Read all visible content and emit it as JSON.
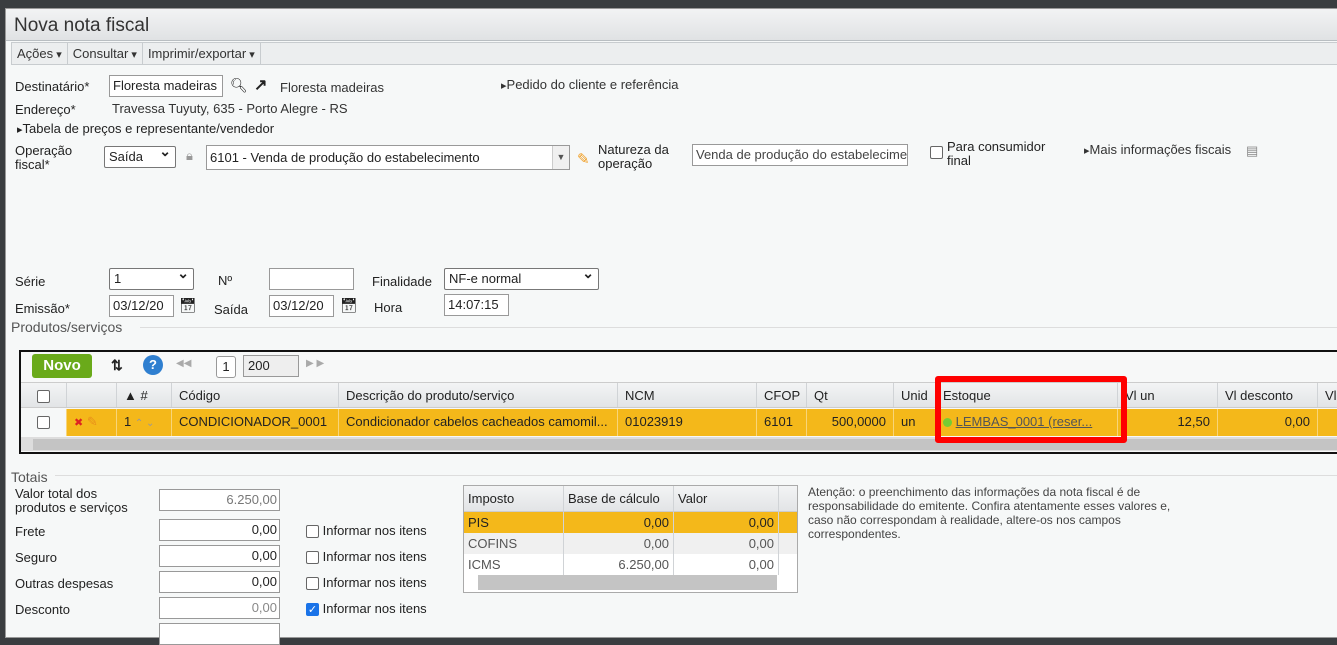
{
  "window": {
    "title": "Nova nota fiscal"
  },
  "menu": [
    "Ações",
    "Consultar",
    "Imprimir/exportar"
  ],
  "header": {
    "destinatario_label": "Destinatário*",
    "destinatario_value": "Floresta madeiras",
    "destinatario_link": "Floresta madeiras",
    "pedido_link": "Pedido do cliente e referência",
    "endereco_label": "Endereço*",
    "endereco_value": "Travessa Tuyuty, 635 - Porto Alegre - RS",
    "tabela_link": "Tabela de preços e representante/vendedor",
    "operacao_label_1": "Operação",
    "operacao_label_2": "fiscal*",
    "operacao_value": "Saída",
    "cfop_value": "6101 - Venda de produção do estabelecimento",
    "natureza_label_1": "Natureza da",
    "natureza_label_2": "operação",
    "natureza_value": "Venda de produção do estabelecimento",
    "consumidor_label_1": "Para consumidor",
    "consumidor_label_2": "final",
    "mais_info": "Mais informações fiscais",
    "serie_label": "Série",
    "serie_value": "1",
    "numero_label": "Nº",
    "numero_value": "",
    "finalidade_label": "Finalidade",
    "finalidade_value": "NF-e normal",
    "emissao_label": "Emissão*",
    "emissao_value": "03/12/20",
    "saida_label": "Saída",
    "saida_value": "03/12/20",
    "hora_label": "Hora",
    "hora_value": "14:07:15"
  },
  "produtos": {
    "section": "Produtos/serviços",
    "novo": "Novo",
    "page": "1",
    "page_size": "200",
    "columns": [
      "#",
      "Código",
      "Descrição do produto/serviço",
      "NCM",
      "CFOP",
      "Qt",
      "Unid",
      "Estoque",
      "Vl un",
      "Vl desconto",
      "Vl"
    ],
    "rows": [
      {
        "num": "1",
        "codigo": "CONDICIONADOR_0001",
        "descricao": "Condicionador cabelos cacheados camomil...",
        "ncm": "01023919",
        "cfop": "6101",
        "qt": "500,0000",
        "unid": "un",
        "estoque": "LEMBAS_0001 (reser...",
        "vl_un": "12,50",
        "vl_desconto": "0,00"
      }
    ]
  },
  "totais": {
    "section": "Totais",
    "rows": [
      {
        "label1": "Valor total dos",
        "label2": "produtos e serviços",
        "value": "6.250,00"
      },
      {
        "label": "Frete",
        "value": "0,00",
        "check": "Informar nos itens",
        "checked": false
      },
      {
        "label": "Seguro",
        "value": "0,00",
        "check": "Informar nos itens",
        "checked": false
      },
      {
        "label": "Outras despesas",
        "value": "0,00",
        "check": "Informar nos itens",
        "checked": false
      },
      {
        "label": "Desconto",
        "value": "0,00",
        "check": "Informar nos itens",
        "checked": true
      }
    ],
    "tax_columns": [
      "Imposto",
      "Base de cálculo",
      "Valor"
    ],
    "taxes": [
      {
        "imposto": "PIS",
        "base": "0,00",
        "valor": "0,00"
      },
      {
        "imposto": "COFINS",
        "base": "0,00",
        "valor": "0,00"
      },
      {
        "imposto": "ICMS",
        "base": "6.250,00",
        "valor": "0,00"
      }
    ],
    "notice": "Atenção: o preenchimento das informações da nota fiscal é de responsabilidade do emitente. Confira atentamente esses valores e, caso não correspondam à realidade, altere-os nos campos correspondentes."
  },
  "colors": {
    "highlight": "#f4b81a",
    "novo": "#6aaa1a",
    "annotation": "#ff0000"
  }
}
